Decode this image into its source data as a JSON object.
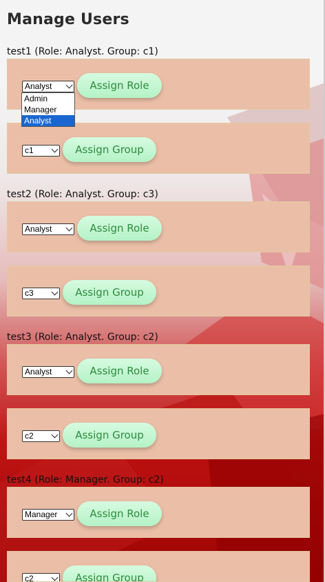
{
  "page": {
    "title": "Manage Users"
  },
  "users": [
    {
      "label": "test1 (Role: Analyst. Group: c1)",
      "role_value": "Analyst",
      "group_value": "c1"
    },
    {
      "label": "test2 (Role: Analyst. Group: c3)",
      "role_value": "Analyst",
      "group_value": "c3"
    },
    {
      "label": "test3 (Role: Analyst. Group: c2)",
      "role_value": "Analyst",
      "group_value": "c2"
    },
    {
      "label": "test4 (Role: Manager. Group: c2)",
      "role_value": "Manager",
      "group_value": "c2"
    }
  ],
  "buttons": {
    "assign_role": "Assign Role",
    "assign_group": "Assign Group"
  },
  "role_options": [
    "Admin",
    "Manager",
    "Analyst"
  ],
  "open_dropdown_selected": "Analyst",
  "colors": {
    "card_bg": "#ebbfa7",
    "button_bg": "#c4f5d2",
    "button_text": "#2e8b3f",
    "dropdown_highlight": "#1a66d1",
    "background_red": "#c01414"
  }
}
